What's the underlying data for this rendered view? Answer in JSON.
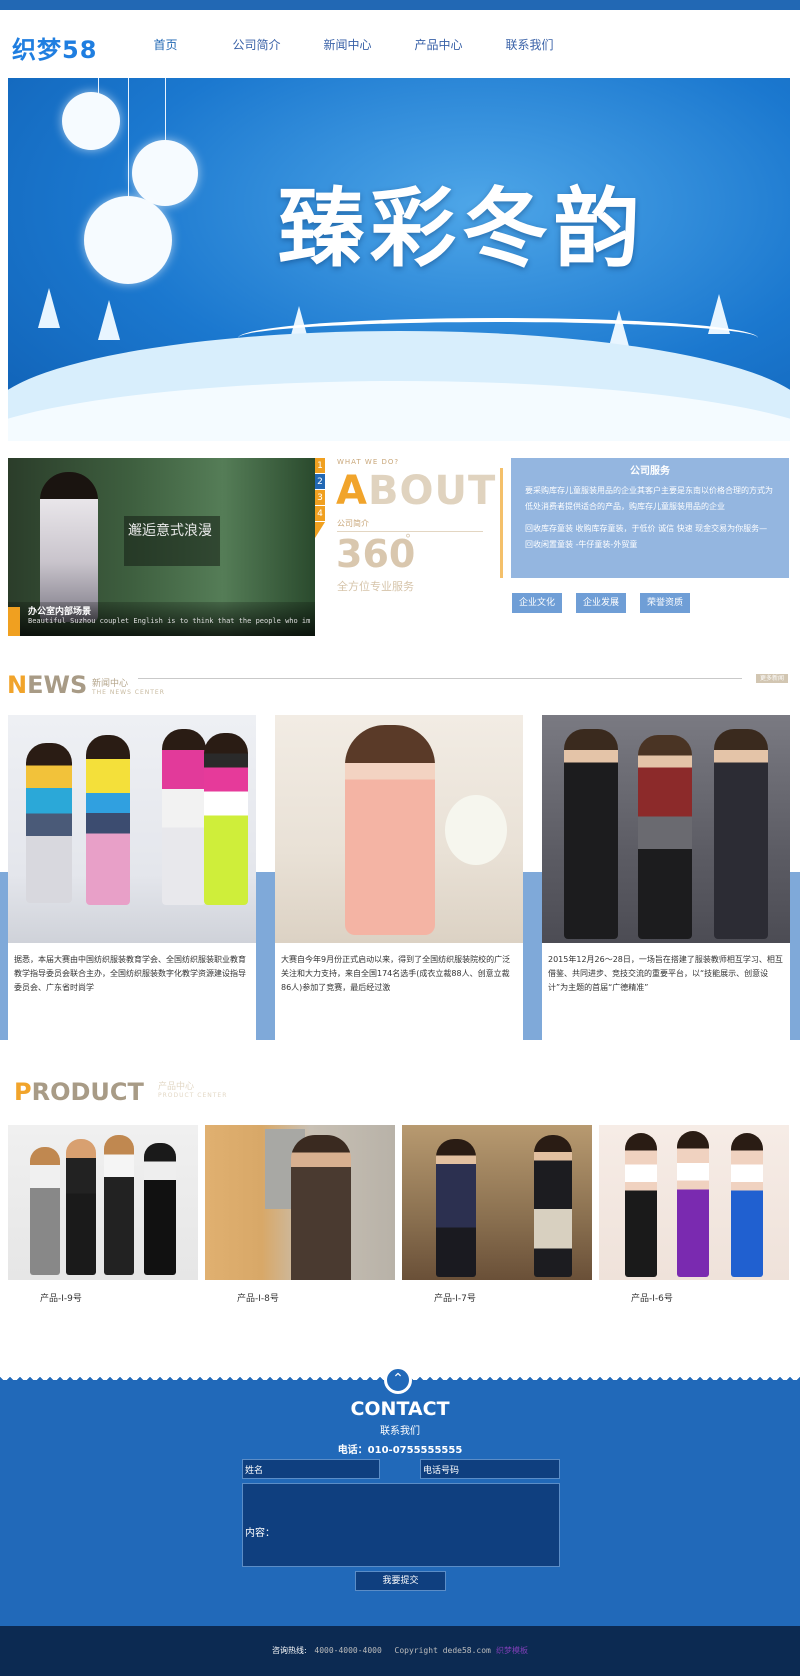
{
  "header": {
    "logo": "织梦58",
    "nav": [
      "首页",
      "公司简介",
      "新闻中心",
      "产品中心",
      "联系我们"
    ]
  },
  "banner": {
    "title": "臻彩冬韵"
  },
  "about": {
    "slide_nums": [
      "1",
      "2",
      "3",
      "4"
    ],
    "slide_sign": "邂逅意式浪漫",
    "slide_caption_title": "办公室内部场景",
    "slide_caption_text": "Beautiful Suzhou couplet English is to think that the people who improves greatly beautiful ability and provided the approach that this studies boundlessly",
    "what": "WHAT WE DO?",
    "big_first": "A",
    "big_rest": "BOUT",
    "sub": "公司简介",
    "number": "360",
    "degree": "°",
    "tagline": "全方位专业服务",
    "service_title": "公司服务",
    "service_p1": "要采购库存儿童服装用品的企业其客户主要是东南以价格合理的方式为低处消费者提供适合的产品，购库存儿童服装用品的企业",
    "service_p2": "回收库存童装 收购库存童装，于低价 诚信 快速 现金交易为你服务—回收闲置童装 -牛仔童装-外贸童",
    "buttons": [
      "企业文化",
      "企业发展",
      "荣誉资质"
    ]
  },
  "news": {
    "title_first": "N",
    "title_rest": "EWS",
    "cn": "新闻中心",
    "en": "THE NEWS CENTER",
    "more": "更多新闻",
    "items": [
      {
        "text": "据悉，本届大赛由中国纺织服装教育学会、全国纺织服装职业教育教学指导委员会联合主办，全国纺织服装数字化教学资源建设指导委员会、广东省时尚学"
      },
      {
        "text": "大赛自今年9月份正式启动以来，得到了全国纺织服装院校的广泛关注和大力支持，来自全国174名选手(成衣立裁88人、创意立裁86人)参加了竞赛，最后经过激"
      },
      {
        "text": "2015年12月26～28日，一场旨在搭建了服装教师相互学习、相互借鉴、共同进步、竞技交流的重要平台，以“技能展示、创意设计”为主题的首届“广德精准”"
      }
    ]
  },
  "product": {
    "title_first": "P",
    "title_rest": "RODUCT",
    "cn": "产品中心",
    "en": "PRODUCT CENTER",
    "items": [
      {
        "label": "产品-I-9号"
      },
      {
        "label": "产品-I-8号"
      },
      {
        "label": "产品-I-7号"
      },
      {
        "label": "产品-I-6号"
      }
    ]
  },
  "contact": {
    "icon": "up-arrow-icon",
    "title": "CONTACT",
    "sub": "联系我们",
    "tel": "电话：010-0755555555",
    "name_label": "姓名",
    "phone_label": "电话号码",
    "content_label": "内容：",
    "submit": "我要提交"
  },
  "footer": {
    "hotline_label": "咨询热线:",
    "hotline": "4000-4000-4000",
    "copyright": "Copyright dede58.com",
    "link": "织梦模板"
  },
  "colors": {
    "brand_blue": "#2268b4",
    "accent_orange": "#f1a42b",
    "service_blue": "#94b6e0",
    "footer_navy": "#0c2a52"
  }
}
